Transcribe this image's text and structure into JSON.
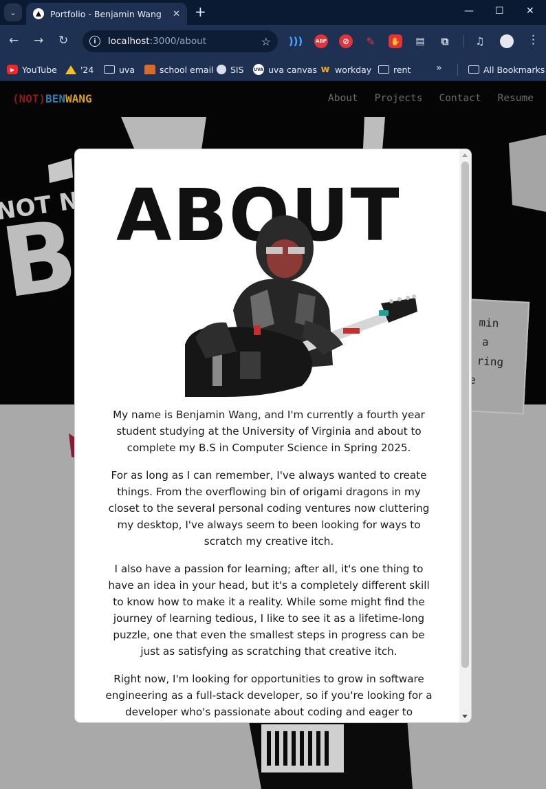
{
  "browser": {
    "tab_title": "Portfolio - Benjamin Wang",
    "url_host": "localhost",
    "url_path": ":3000/about",
    "window_controls": {
      "minimize": "—",
      "maximize": "☐",
      "close": "✕"
    },
    "extensions": [
      "wave-icon",
      "adblock-plus-icon",
      "block-icon",
      "pen-icon",
      "ublock-icon",
      "document-icon",
      "puzzle-icon",
      "media-icon"
    ],
    "bookmarks": [
      {
        "label": "YouTube",
        "icon": "youtube-icon"
      },
      {
        "label": "'24",
        "icon": "google-drive-icon"
      },
      {
        "label": "uva",
        "icon": "folder-icon"
      },
      {
        "label": "school email",
        "icon": "school-icon"
      },
      {
        "label": "SIS",
        "icon": "globe-icon"
      },
      {
        "label": "uva canvas",
        "icon": "uva-icon"
      },
      {
        "label": "workday",
        "icon": "workday-icon"
      },
      {
        "label": "rent",
        "icon": "folder-icon"
      }
    ],
    "all_bookmarks_label": "All Bookmarks"
  },
  "site": {
    "logo": {
      "paren_part": "(NOT)",
      "ben_part": "BEN",
      "wang_part": "WANG"
    },
    "nav": [
      "About",
      "Projects",
      "Contact",
      "Resume"
    ],
    "background": {
      "not_no": "NOT NO",
      "big_letter": "B",
      "card_lines": [
        "min",
        " a",
        "ring",
        "e"
      ]
    },
    "about": {
      "title": "ABOUT",
      "paragraphs": [
        "My name is Benjamin Wang, and I'm currently a fourth year student studying at the University of Virginia and about to complete my B.S in Computer Science in Spring 2025.",
        "For as long as I can remember, I've always wanted to create things. From the overflowing bin of origami dragons in my closet to the several personal coding ventures now cluttering my desktop, I've always seem to been looking for ways to scratch my creative itch.",
        "I also have a passion for learning; after all, it's one thing to have an idea in your head, but it's a completely different skill to know how to make it a reality. While some might find the journey of learning tedious, I like to see it as a lifetime-long puzzle, one that even the smallest steps in progress can be just as satisfying as scratching that creative itch.",
        "Right now, I'm looking for opportunities to grow in software engineering as a full-stack developer, so if you're looking for a developer who's passionate about coding and eager to"
      ]
    }
  },
  "colors": {
    "tabbar": "#0b1a33",
    "toolbar": "#1f3152",
    "logo_red": "#8e1b1b",
    "logo_blue": "#2b7fb3",
    "logo_yellow": "#d9a21b",
    "site_gray": "#a9a9a9"
  }
}
